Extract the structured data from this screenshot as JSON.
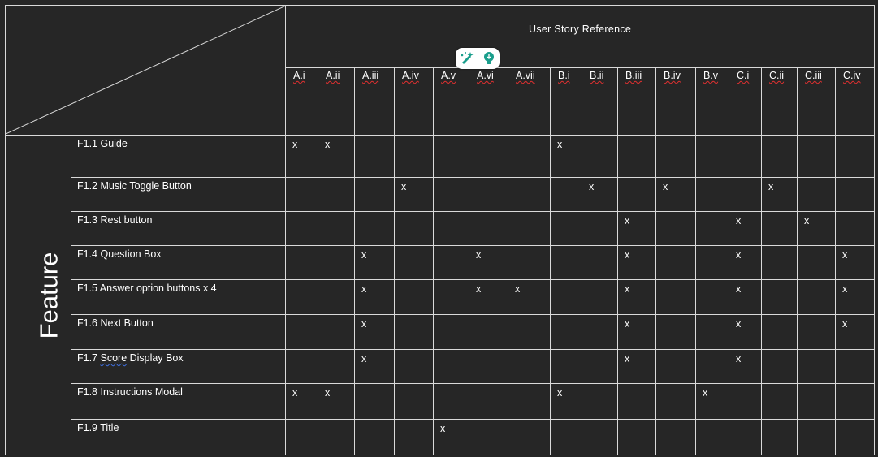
{
  "header": {
    "title": "User Story Reference",
    "side_label": "Feature"
  },
  "columns": [
    "A.i",
    "A.ii",
    "A.iii",
    "A.iv",
    "A.v",
    "A.vi",
    "A.vii",
    "B.i",
    "B.ii",
    "B.iii",
    "B.iv",
    "B.v",
    "C.i",
    "C.ii",
    "C.iii",
    "C.iv"
  ],
  "rows": [
    {
      "label_pre": "F1.1 Guide",
      "label_link": "",
      "label_post": "",
      "marks": [
        "x",
        "x",
        "",
        "",
        "",
        "",
        "",
        "x",
        "",
        "",
        "",
        "",
        "",
        "",
        "",
        ""
      ]
    },
    {
      "label_pre": "F1.2 Music Toggle Button",
      "label_link": "",
      "label_post": "",
      "marks": [
        "",
        "",
        "",
        "x",
        "",
        "",
        "",
        "",
        "x",
        "",
        "x",
        "",
        "",
        "x",
        "",
        ""
      ]
    },
    {
      "label_pre": "F1.3 Rest button",
      "label_link": "",
      "label_post": "",
      "marks": [
        "",
        "",
        "",
        "",
        "",
        "",
        "",
        "",
        "",
        "x",
        "",
        "",
        "x",
        "",
        "x",
        ""
      ]
    },
    {
      "label_pre": "F1.4 Question Box",
      "label_link": "",
      "label_post": "",
      "marks": [
        "",
        "",
        "x",
        "",
        "",
        "x",
        "",
        "",
        "",
        "x",
        "",
        "",
        "x",
        "",
        "",
        "x"
      ]
    },
    {
      "label_pre": "F1.5 Answer option buttons x 4",
      "label_link": "",
      "label_post": "",
      "marks": [
        "",
        "",
        "x",
        "",
        "",
        "x",
        "x",
        "",
        "",
        "x",
        "",
        "",
        "x",
        "",
        "",
        "x"
      ]
    },
    {
      "label_pre": "F1.6 Next Button",
      "label_link": "",
      "label_post": "",
      "marks": [
        "",
        "",
        "x",
        "",
        "",
        "",
        "",
        "",
        "",
        "x",
        "",
        "",
        "x",
        "",
        "",
        "x"
      ]
    },
    {
      "label_pre": "F1.7 ",
      "label_link": "Score",
      "label_post": " Display Box",
      "marks": [
        "",
        "",
        "x",
        "",
        "",
        "",
        "",
        "",
        "",
        "x",
        "",
        "",
        "x",
        "",
        "",
        ""
      ]
    },
    {
      "label_pre": "F1.8 Instructions Modal",
      "label_link": "",
      "label_post": "",
      "marks": [
        "x",
        "x",
        "",
        "",
        "",
        "",
        "",
        "x",
        "",
        "",
        "",
        "x",
        "",
        "",
        "",
        ""
      ]
    },
    {
      "label_pre": "F1.9 Title",
      "label_link": "",
      "label_post": "",
      "marks": [
        "",
        "",
        "",
        "",
        "x",
        "",
        "",
        "",
        "",
        "",
        "",
        "",
        "",
        "",
        "",
        ""
      ]
    }
  ],
  "floating_toolbar": {
    "icons": [
      "rewrite-sparkle-icon",
      "lightbulb-icon"
    ]
  },
  "colors": {
    "background": "#262626",
    "grid_line": "#d9d9d9",
    "text": "#ffffff",
    "spell_underline": "#e03030",
    "grammar_underline": "#3f6fe0",
    "toolbar_icon": "#1a9e8c"
  }
}
